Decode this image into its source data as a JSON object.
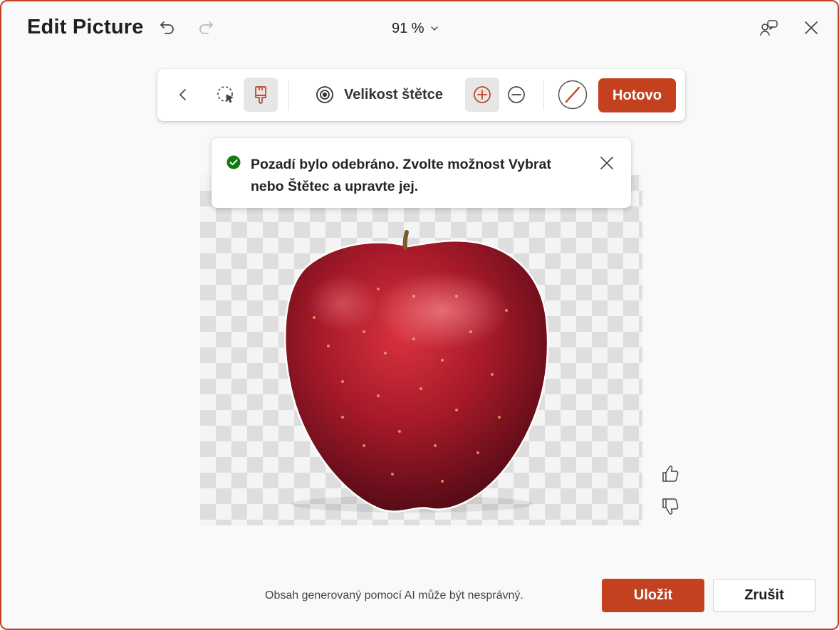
{
  "window": {
    "title": "Edit Picture",
    "zoom_label": "91 %",
    "accent_color": "#c4411f"
  },
  "titlebar_icons": {
    "undo": "undo-icon",
    "redo": "redo-icon",
    "zoom_dropdown": "chevron-down-icon",
    "feedback": "comment-icon",
    "close": "close-icon"
  },
  "toolbar": {
    "back_icon": "chevron-left-icon",
    "select_icon": "lasso-select-icon",
    "brush_icon": "brush-icon",
    "brush_size_icon": "target-icon",
    "brush_size_label": "Velikost štětce",
    "increase_icon": "plus-circle-icon",
    "decrease_icon": "minus-circle-icon",
    "eraser_icon": "slash-circle-icon",
    "done_label": "Hotovo"
  },
  "toast": {
    "status_icon": "check-circle-icon",
    "status_color": "#107c10",
    "message": "Pozadí bylo odebráno. Zvolte možnost Vybrat nebo Štětec a upravte jej."
  },
  "feedback": {
    "thumbs_up_icon": "thumbs-up-icon",
    "thumbs_down_icon": "thumbs-down-icon"
  },
  "footer": {
    "disclaimer": "Obsah generovaný pomocí AI může být nesprávný.",
    "save_label": "Uložit",
    "cancel_label": "Zrušit"
  }
}
